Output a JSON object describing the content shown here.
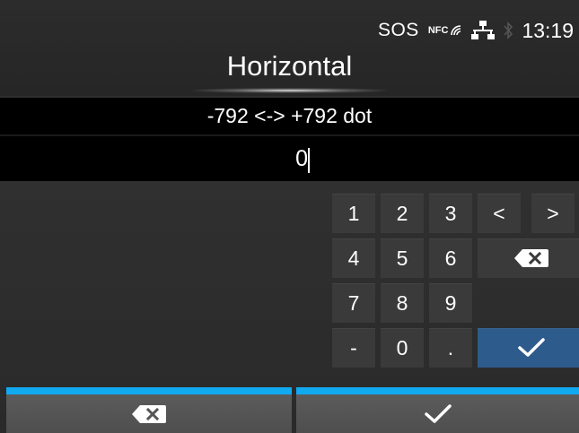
{
  "status_bar": {
    "sos": "SOS",
    "nfc": "NFC",
    "time": "13:19"
  },
  "title": "Horizontal",
  "range": "-792 <-> +792 dot",
  "value": "0",
  "keypad": {
    "k1": "1",
    "k2": "2",
    "k3": "3",
    "k4": "4",
    "k5": "5",
    "k6": "6",
    "k7": "7",
    "k8": "8",
    "k9": "9",
    "minus": "-",
    "k0": "0",
    "dot": ".",
    "left": "<",
    "right": ">"
  },
  "colors": {
    "accent": "#11aaf0",
    "ok_key": "#2d5b8b"
  },
  "icons": {
    "backspace": "backspace-icon",
    "confirm": "check-icon",
    "network": "network-icon",
    "bluetooth": "bluetooth-icon"
  }
}
